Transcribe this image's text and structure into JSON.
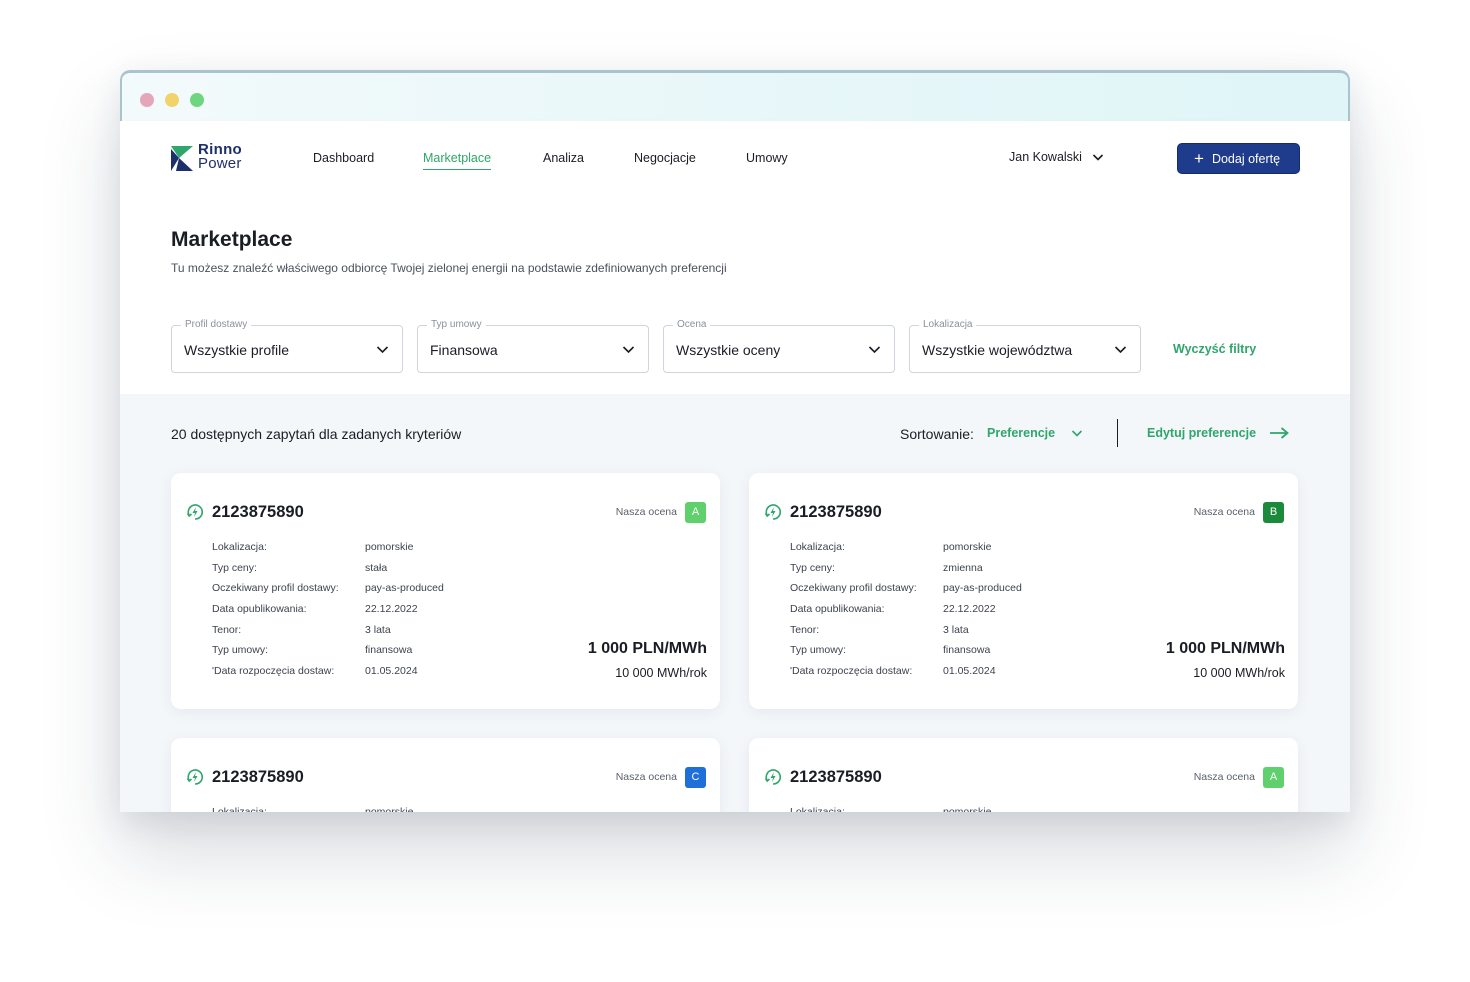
{
  "colors": {
    "accent_green": "#2fa66b",
    "primary_blue": "#1e3b8c",
    "rating_A": "#5fd06c",
    "rating_B": "#1b8a3a",
    "rating_C": "#1e6fd9"
  },
  "nav": {
    "logo": {
      "line1": "Rinno",
      "line2": "Power"
    },
    "items": [
      {
        "label": "Dashboard"
      },
      {
        "label": "Marketplace"
      },
      {
        "label": "Analiza"
      },
      {
        "label": "Negocjacje"
      },
      {
        "label": "Umowy"
      }
    ],
    "active": "Marketplace",
    "user": "Jan Kowalski",
    "add_button": "Dodaj ofertę",
    "icons": {
      "user_menu": "chevron-down-icon",
      "add": "plus-icon"
    }
  },
  "page": {
    "title": "Marketplace",
    "subtitle": "Tu możesz znaleźć właściwego odbiorcę Twojej zielonej energii na podstawie zdefiniowanych preferencji"
  },
  "filters": [
    {
      "label": "Profil dostawy",
      "value": "Wszystkie profile"
    },
    {
      "label": "Typ umowy",
      "value": "Finansowa"
    },
    {
      "label": "Ocena",
      "value": "Wszystkie oceny"
    },
    {
      "label": "Lokalizacja",
      "value": "Wszystkie województwa"
    }
  ],
  "clear_filters": "Wyczyść filtry",
  "results": {
    "count_text": "20 dostępnych zapytań dla zadanych kryteriów",
    "sort_label": "Sortowanie:",
    "sort_value": "Preferencje",
    "edit_preferences": "Edytuj preferencje"
  },
  "detail_labels": {
    "location": "Lokalizacja:",
    "price_type": "Typ ceny:",
    "profile": "Oczekiwany profil dostawy:",
    "published": "Data opublikowania:",
    "tenor": "Tenor:",
    "contract_type": "Typ umowy:",
    "start_date": "'Data rozpoczęcia dostaw:"
  },
  "cards": [
    {
      "id": "2123875890",
      "rating_label": "Nasza ocena",
      "rating": "A",
      "location": "pomorskie",
      "price_type": "stała",
      "profile": "pay-as-produced",
      "published": "22.12.2022",
      "tenor": "3 lata",
      "contract_type": "finansowa",
      "start_date": "01.05.2024",
      "price": "1 000 PLN/MWh",
      "volume": "10 000 MWh/rok"
    },
    {
      "id": "2123875890",
      "rating_label": "Nasza ocena",
      "rating": "B",
      "location": "pomorskie",
      "price_type": "zmienna",
      "profile": "pay-as-produced",
      "published": "22.12.2022",
      "tenor": "3 lata",
      "contract_type": "finansowa",
      "start_date": "01.05.2024",
      "price": "1 000 PLN/MWh",
      "volume": "10 000 MWh/rok"
    },
    {
      "id": "2123875890",
      "rating_label": "Nasza ocena",
      "rating": "C",
      "location": "pomorskie"
    },
    {
      "id": "2123875890",
      "rating_label": "Nasza ocena",
      "rating": "A",
      "location": "pomorskie"
    }
  ]
}
